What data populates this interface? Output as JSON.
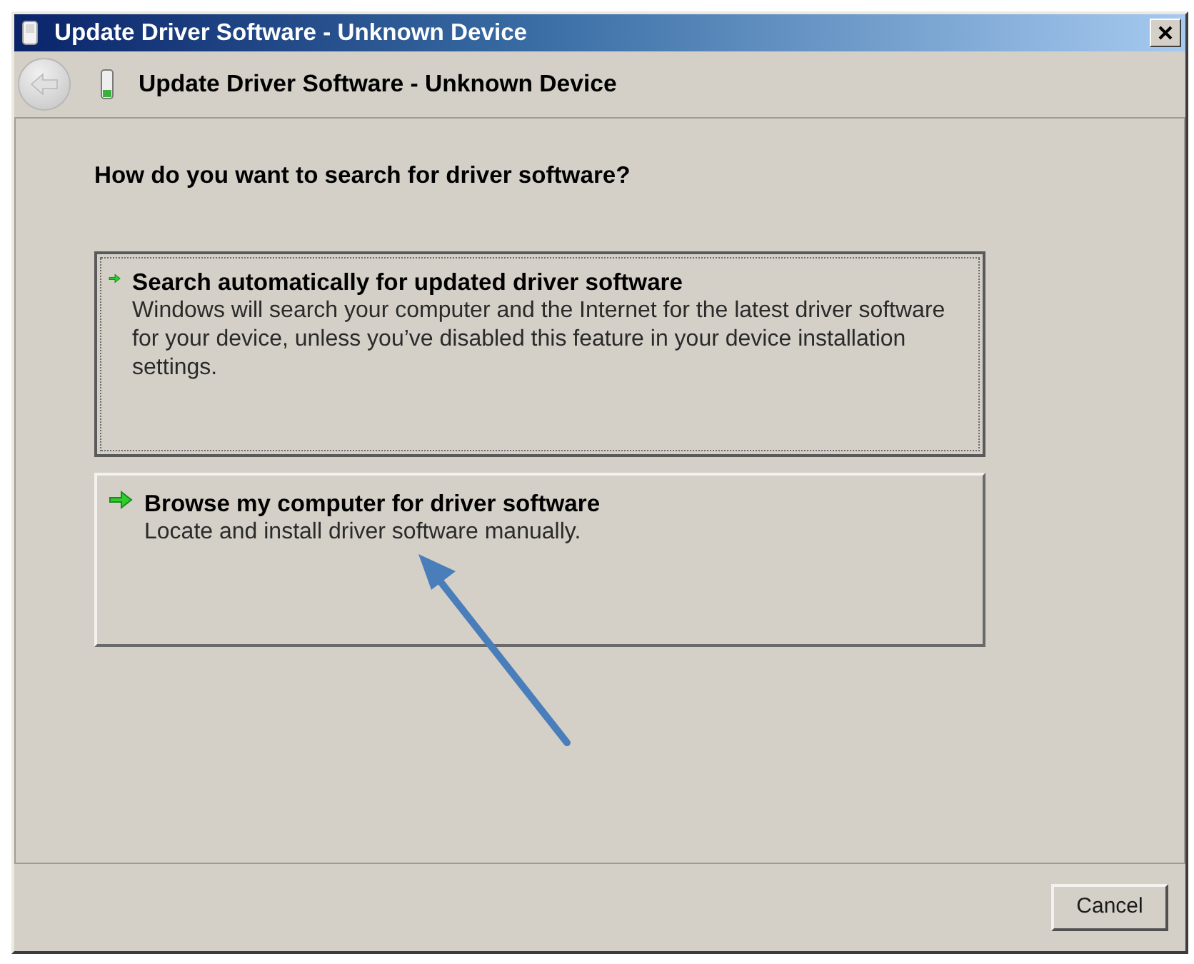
{
  "window": {
    "title": "Update Driver Software - Unknown Device"
  },
  "header": {
    "title": "Update Driver Software - Unknown Device",
    "back_button": {
      "disabled": true
    }
  },
  "content": {
    "question": "How do you want to search for driver software?",
    "options": [
      {
        "title": "Search automatically for updated driver software",
        "description": "Windows will search your computer and the Internet for the latest driver software for your device, unless you’ve disabled this feature in your device installation settings.",
        "selected": true
      },
      {
        "title": "Browse my computer for driver software",
        "description": "Locate and install driver software manually.",
        "selected": false
      }
    ]
  },
  "annotations": [
    {
      "kind": "arrow"
    }
  ],
  "buttons": [
    {
      "label": "Cancel"
    }
  ]
}
